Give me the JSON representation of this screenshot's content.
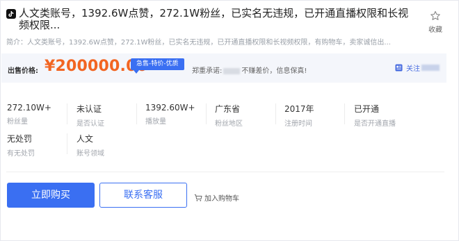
{
  "title": "人文类账号，1392.6W点赞，272.1W粉丝，已实名无违规，已开通直播权限和长视频权限...",
  "favorite": {
    "label": "收藏"
  },
  "summary": "简介：人文类账号，1392.6W点赞，272.1W粉丝，已实名无违规，已开通直播权限和长视频权限，有购物车，卖家诚信出...",
  "price": {
    "label": "出售价格:",
    "value": "¥200000.00",
    "badge": "急售-特价-优质",
    "promise": "郑重承诺:",
    "promise_tail": "不赚差价，信息保真!",
    "follow_label": "关注"
  },
  "stats": [
    {
      "value": "272.10W+",
      "label": "粉丝量"
    },
    {
      "value": "未认证",
      "label": "是否认证"
    },
    {
      "value": "1392.60W+",
      "label": "播放量"
    },
    {
      "value": "广东省",
      "label": "粉丝地区"
    },
    {
      "value": "2017年",
      "label": "注册时间"
    },
    {
      "value": "已开通",
      "label": "是否开通直播"
    },
    {
      "value": "无处罚",
      "label": "有无处罚"
    },
    {
      "value": "人文",
      "label": "账号领域"
    }
  ],
  "actions": {
    "buy_label": "立即购买",
    "service_label": "联系客服",
    "cart_label": "加入购物车"
  },
  "colors": {
    "accent": "#3a6ff2",
    "price": "#f26522"
  }
}
